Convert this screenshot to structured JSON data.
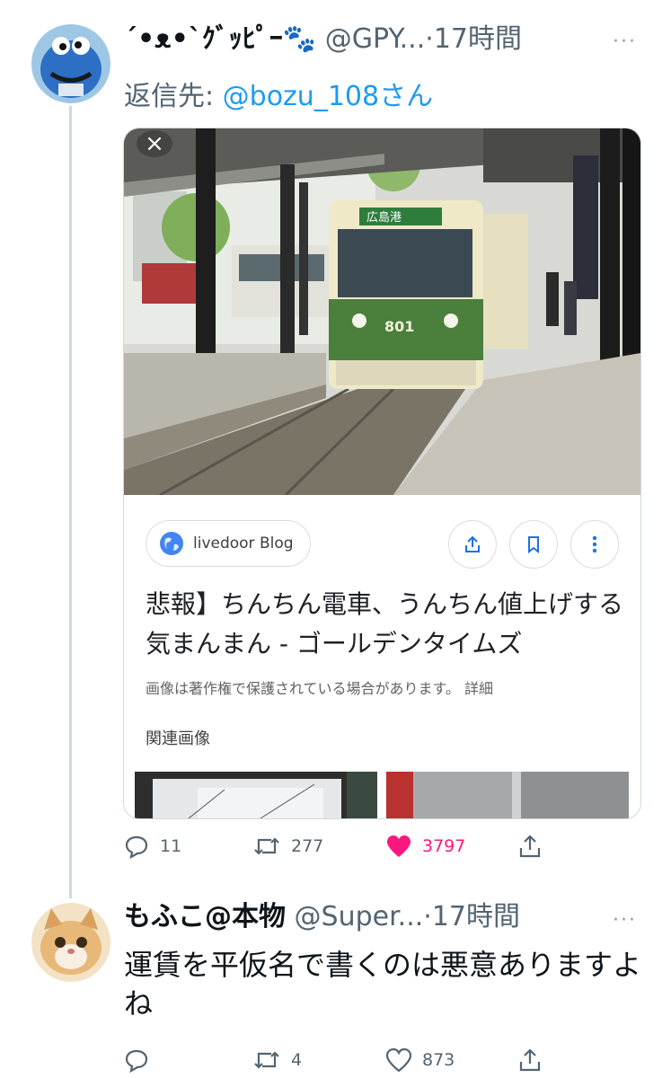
{
  "tweet1": {
    "display_name": "´•ᴥ•`ｸﾞｯﾋﾟｰ🐾",
    "handle": "@GPY...",
    "separator": "·",
    "time": "17時間",
    "more": "···",
    "reply_label": "返信先:",
    "reply_mention": "@bozu_108さん",
    "card": {
      "close": "×",
      "source": "livedoor Blog",
      "title": "悲報】ちんちん電車、うんちん値上げする気まんまん - ゴールデンタイムズ",
      "copyright": "画像は著作権で保護されている場合があります。 詳細",
      "related": "関連画像",
      "tram_number": "801",
      "tram_sign": "広島港"
    },
    "stats": {
      "replies": "11",
      "retweets": "277",
      "likes": "3797"
    }
  },
  "tweet2": {
    "display_name": "もふこ@本物",
    "handle": "@Super...",
    "separator": "·",
    "time": "17時間",
    "more": "···",
    "text": "運賃を平仮名で書くのは悪意ありますよね",
    "stats": {
      "replies": "",
      "retweets": "4",
      "likes": "873"
    }
  },
  "colors": {
    "accent": "#1d9bf0",
    "like": "#f91880",
    "muted": "#536471",
    "tram_green": "#4a7f3c"
  },
  "icons": [
    "reply-icon",
    "retweet-icon",
    "heart-icon",
    "share-icon",
    "globe-icon",
    "bookmark-icon",
    "kebab-icon",
    "close-icon"
  ]
}
